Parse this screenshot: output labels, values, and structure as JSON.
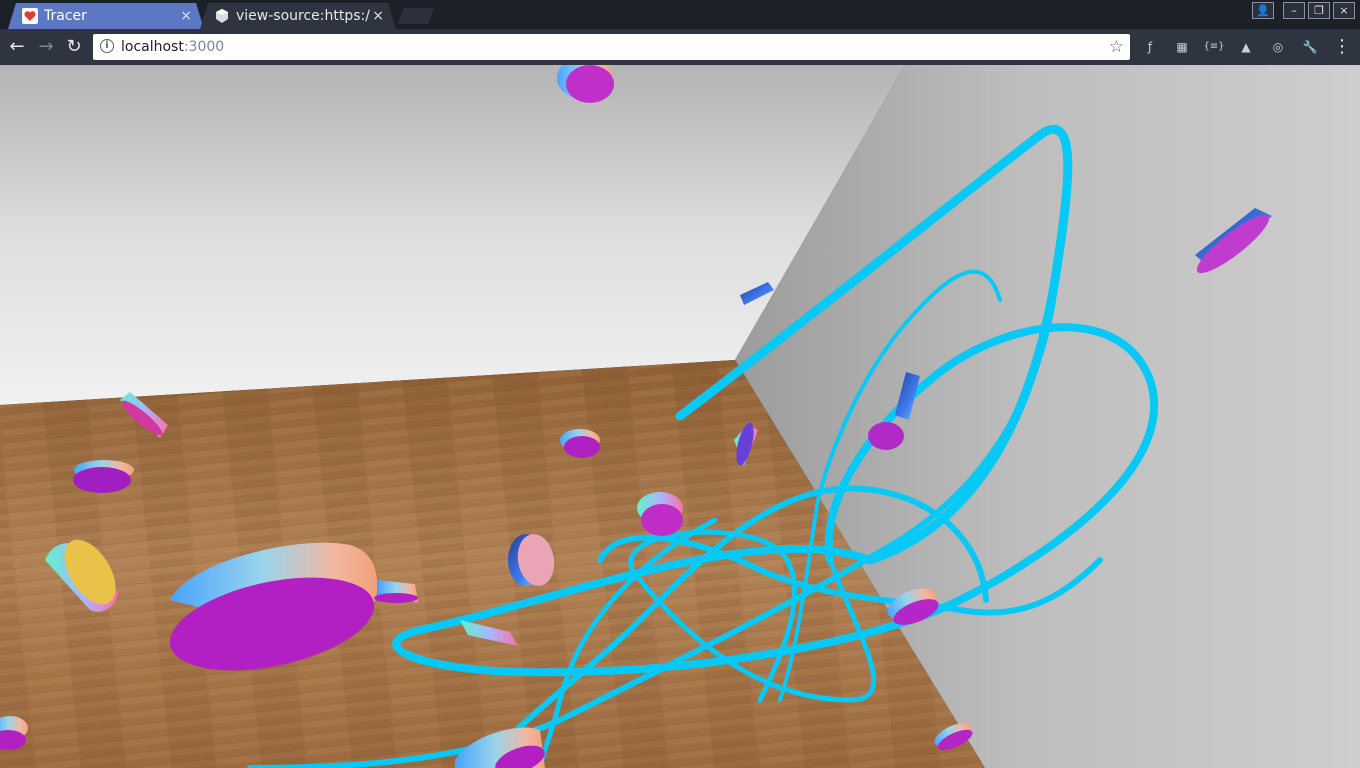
{
  "tabs": [
    {
      "title": "Tracer",
      "close_icon": "×",
      "active": true
    },
    {
      "title": "view-source:https://",
      "close_icon": "×",
      "active": false
    }
  ],
  "window_controls": {
    "profile": "👤",
    "minimize": "–",
    "restore": "❐",
    "close": "×"
  },
  "toolbar": {
    "back": "←",
    "forward": "→",
    "reload": "↻",
    "url_host": "localhost",
    "url_port": ":3000",
    "info_icon": "i",
    "bookmark_star": "☆",
    "menu": "⋮"
  },
  "extensions": [
    {
      "name": "fedora-icon",
      "glyph": "ƒ"
    },
    {
      "name": "extension-gray-icon",
      "glyph": "▦"
    },
    {
      "name": "json-viewer-icon",
      "glyph": "{≡}"
    },
    {
      "name": "triangle-ext-icon",
      "glyph": "▲"
    },
    {
      "name": "screenshot-ext-icon",
      "glyph": "◎"
    },
    {
      "name": "wrench-ext-icon",
      "glyph": "🔧"
    }
  ],
  "scene": {
    "description_colors": {
      "wall_back": "#b9b9b9",
      "wall_right": "#c6c6c6",
      "floor": "#9a6a3c",
      "trail": "#08c8f6",
      "disc_face": "#b21fc2"
    }
  }
}
